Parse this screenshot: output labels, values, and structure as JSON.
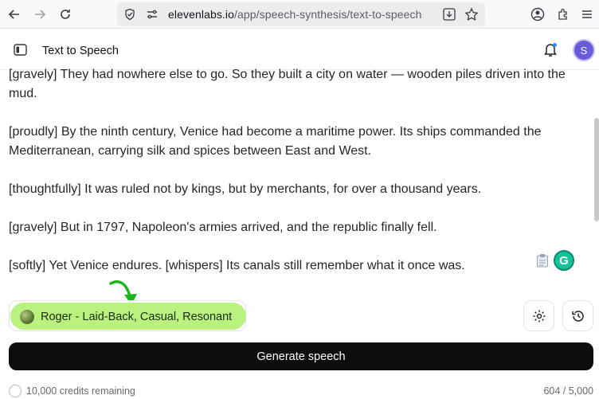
{
  "browser": {
    "url_host": "elevenlabs.io",
    "url_path": "/app/speech-synthesis/text-to-speech"
  },
  "header": {
    "title": "Text to Speech",
    "avatar_initial": "S"
  },
  "editor": {
    "paragraphs": [
      "[gravely] They had nowhere else to go. So they built a city on water — wooden piles driven into the mud.",
      "[proudly] By the ninth century, Venice had become a maritime power. Its ships commanded the Mediterranean, carrying silk and spices between East and West.",
      "[thoughtfully] It was ruled not by kings, but by merchants, for over a thousand years.",
      "[gravely] But in 1797, Napoleon's armies arrived, and the republic finally fell.",
      "[softly] Yet Venice endures. [whispers] Its canals still remember what it once was."
    ]
  },
  "voice": {
    "label": "Roger - Laid-Back, Casual, Resonant",
    "highlight_color": "#b6f178"
  },
  "actions": {
    "generate_label": "Generate speech"
  },
  "footer": {
    "credits": "10,000 credits remaining",
    "char_count": "604 / 5,000"
  },
  "colors": {
    "generate_bg": "#0d0d0d",
    "avatar_bg": "#6a5bd8",
    "grammarly": "#15c39a"
  }
}
